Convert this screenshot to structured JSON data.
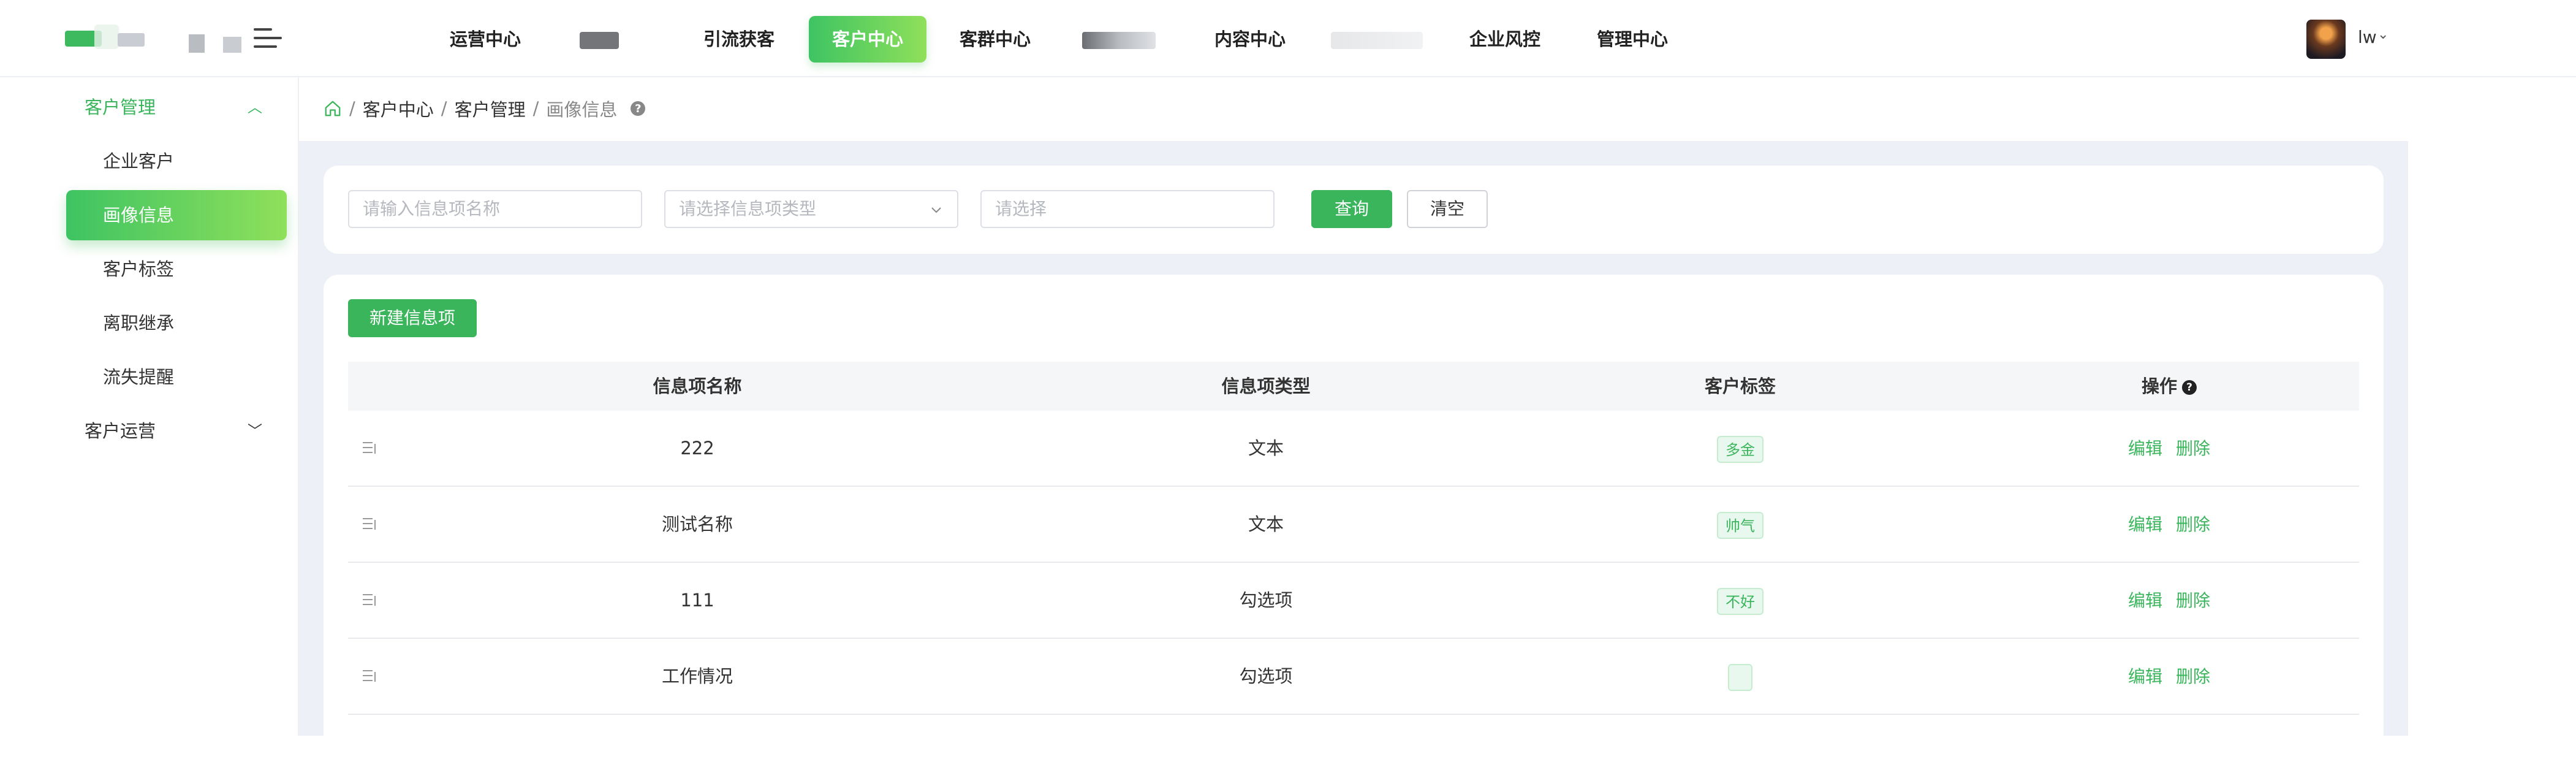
{
  "header": {
    "nav": [
      {
        "label": "运营中心",
        "active": false
      },
      {
        "label": "引流获客",
        "active": false
      },
      {
        "label": "客户中心",
        "active": true
      },
      {
        "label": "客群中心",
        "active": false
      },
      {
        "label": "内容中心",
        "active": false
      },
      {
        "label": "企业风控",
        "active": false
      },
      {
        "label": "管理中心",
        "active": false
      }
    ],
    "user": {
      "name": "lw",
      "caret": "⌄"
    }
  },
  "sidebar": {
    "group1": {
      "label": "客户管理",
      "chevron": "︿"
    },
    "items": [
      {
        "label": "企业客户"
      },
      {
        "label": "画像信息"
      },
      {
        "label": "客户标签"
      },
      {
        "label": "离职继承"
      },
      {
        "label": "流失提醒"
      }
    ],
    "group2": {
      "label": "客户运营",
      "chevron": "﹀"
    }
  },
  "breadcrumb": {
    "items": [
      "客户中心",
      "客户管理"
    ],
    "current": "画像信息",
    "help": "?"
  },
  "filters": {
    "name_placeholder": "请输入信息项名称",
    "type_placeholder": "请选择信息项类型",
    "other_placeholder": "请选择",
    "query_label": "查询",
    "clear_label": "清空"
  },
  "toolbar": {
    "new_label": "新建信息项"
  },
  "table": {
    "headers": {
      "name": "信息项名称",
      "type": "信息项类型",
      "tag": "客户标签",
      "op": "操作",
      "op_help": "?"
    },
    "rows": [
      {
        "name": "222",
        "type": "文本",
        "tag": "多金",
        "edit": "编辑",
        "delete": "删除"
      },
      {
        "name": "测试名称",
        "type": "文本",
        "tag": "帅气",
        "edit": "编辑",
        "delete": "删除"
      },
      {
        "name": "111",
        "type": "勾选项",
        "tag": "不好",
        "edit": "编辑",
        "delete": "删除"
      },
      {
        "name": "工作情况",
        "type": "勾选项",
        "tag": "",
        "edit": "编辑",
        "delete": "删除"
      }
    ]
  },
  "colors": {
    "accent": "#3bb55c",
    "accent_light": "#8fe05a",
    "bg": "#edf1f7"
  }
}
